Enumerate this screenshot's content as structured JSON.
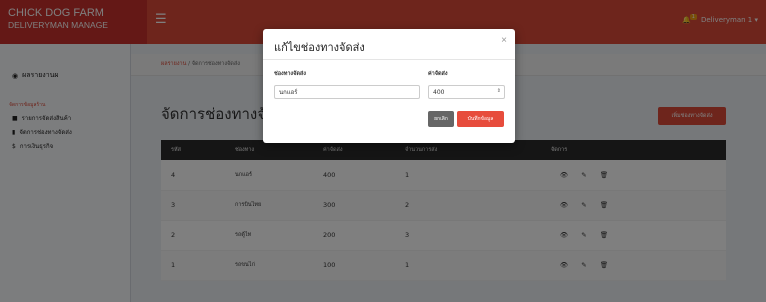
{
  "brand": {
    "line1": "CHICK DOG FARM",
    "line2": "DELIVERYMAN MANAGE"
  },
  "user": {
    "name": "Deliveryman 1 ▾",
    "badge": "1"
  },
  "sidebar": {
    "home": "ผลรายงานผ",
    "section_header": "จัดการข้อมูลร้าน",
    "items": [
      {
        "label": "รายการจัดส่งสินค้า",
        "icon": "truck-icon"
      },
      {
        "label": "จัดการช่องทางจัดส่ง",
        "icon": "bars-icon"
      },
      {
        "label": "การเงินธุรกิจ",
        "icon": "dollar-icon"
      }
    ]
  },
  "breadcrumb": {
    "home": "ผลรายงาน",
    "sep": " / ",
    "current": "จัดการช่องทางจัดส่ง"
  },
  "page": {
    "title": "จัดการช่องทางจัดส่ง",
    "add_button": "เพิ่มช่องทางจัดส่ง"
  },
  "table": {
    "headers": [
      "รหัส",
      "ช่องทาง",
      "ค่าจัดส่ง",
      "จำนวนการส่ง",
      "จัดการ"
    ],
    "rows": [
      {
        "id": "4",
        "channel": "นกแอร์",
        "fee": "400",
        "count": "1"
      },
      {
        "id": "3",
        "channel": "การบินไทย",
        "fee": "300",
        "count": "2"
      },
      {
        "id": "2",
        "channel": "รถตู้ไท",
        "fee": "200",
        "count": "3"
      },
      {
        "id": "1",
        "channel": "รถขนไก่",
        "fee": "100",
        "count": "1"
      }
    ]
  },
  "modal": {
    "title": "แก้ไขช่องทางจัดส่ง",
    "close": "×",
    "channel_label": "ช่องทางจัดส่ง",
    "channel_value": "นกแอร์",
    "fee_label": "ค่าจัดส่ง",
    "fee_value": "400",
    "cancel_label": "ยกเลิก",
    "save_label": "บันทึกข้อมูล"
  },
  "colors": {
    "brand": "#dd4b39",
    "brand_dark": "#c9302c",
    "table_header": "#2a2a2a",
    "save": "#e74c3c"
  }
}
